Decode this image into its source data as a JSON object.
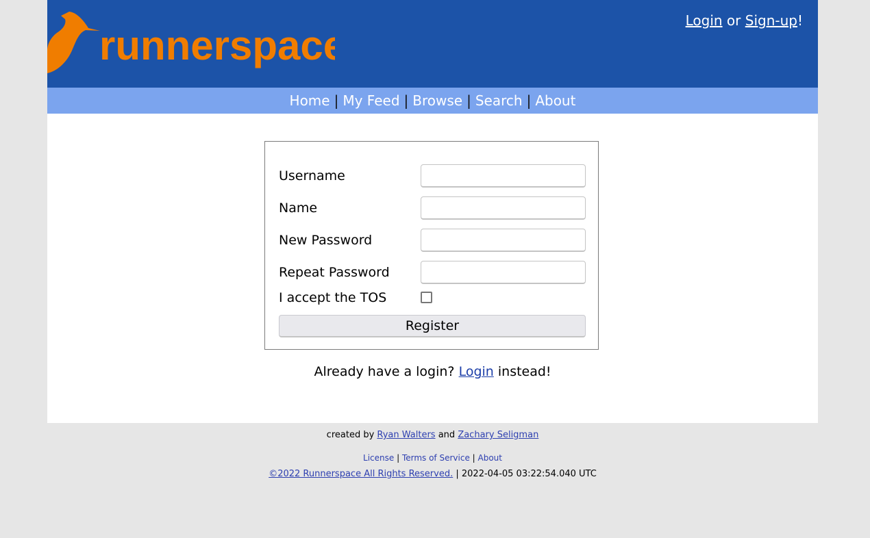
{
  "header": {
    "brand": "runnerspace",
    "auth": {
      "login_label": "Login",
      "or_text": " or ",
      "signup_label": "Sign-up",
      "exclaim": "!"
    }
  },
  "nav": {
    "items": [
      {
        "label": "Home"
      },
      {
        "label": "My Feed"
      },
      {
        "label": "Browse"
      },
      {
        "label": "Search"
      },
      {
        "label": "About"
      }
    ],
    "separator": "|"
  },
  "form": {
    "fields": [
      {
        "label": "Username",
        "value": "",
        "type": "text"
      },
      {
        "label": "Name",
        "value": "",
        "type": "text"
      },
      {
        "label": "New Password",
        "value": "",
        "type": "password"
      },
      {
        "label": "Repeat Password",
        "value": "",
        "type": "password"
      }
    ],
    "tos_label": "I accept the TOS",
    "tos_checked": false,
    "submit_label": "Register"
  },
  "already": {
    "prefix": "Already have a login? ",
    "link": "Login",
    "suffix": " instead!"
  },
  "footer": {
    "created_by": "created by ",
    "author1": "Ryan Walters",
    "and": " and ",
    "author2": "Zachary Seligman",
    "links": [
      "License",
      "Terms of Service",
      "About"
    ],
    "copyright": "©2022 Runnerspace All Rights Reserved.",
    "timestamp": " | 2022-04-05 03:22:54.040 UTC"
  },
  "colors": {
    "header_bg": "#1c53a8",
    "nav_bg": "#7ba4ee",
    "brand_orange": "#f07d00",
    "page_bg": "#e6e6e6"
  }
}
